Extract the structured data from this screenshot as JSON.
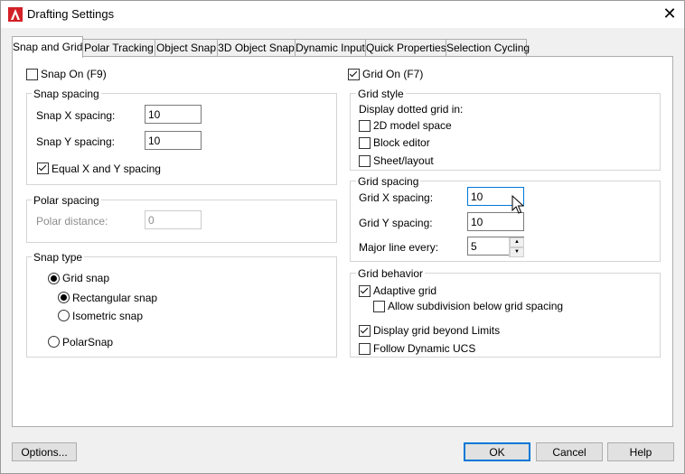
{
  "window": {
    "title": "Drafting Settings",
    "close_glyph": "✕"
  },
  "tabs": [
    "Snap and Grid",
    "Polar Tracking",
    "Object Snap",
    "3D Object Snap",
    "Dynamic Input",
    "Quick Properties",
    "Selection Cycling"
  ],
  "snap": {
    "snap_on": "Snap On (F9)",
    "spacing_legend": "Snap spacing",
    "x_label": "Snap X spacing:",
    "x_value": "10",
    "y_label": "Snap Y spacing:",
    "y_value": "10",
    "equal_label": "Equal X and Y spacing",
    "polar_legend": "Polar spacing",
    "polar_label": "Polar distance:",
    "polar_value": "0",
    "type_legend": "Snap type",
    "grid_snap": "Grid snap",
    "rect_snap": "Rectangular snap",
    "iso_snap": "Isometric snap",
    "polar_snap": "PolarSnap"
  },
  "grid": {
    "grid_on": "Grid On (F7)",
    "style_legend": "Grid style",
    "style_desc": "Display dotted grid in:",
    "model_space": "2D model space",
    "block_editor": "Block editor",
    "sheet_layout": "Sheet/layout",
    "spacing_legend": "Grid spacing",
    "x_label": "Grid X spacing:",
    "x_value": "10",
    "y_label": "Grid Y spacing:",
    "y_value": "10",
    "major_label": "Major line every:",
    "major_value": "5",
    "behavior_legend": "Grid behavior",
    "adaptive": "Adaptive grid",
    "subdivision": "Allow subdivision below grid spacing",
    "beyond_limits": "Display grid beyond Limits",
    "follow_ucs": "Follow Dynamic UCS"
  },
  "buttons": {
    "options": "Options...",
    "ok": "OK",
    "cancel": "Cancel",
    "help": "Help"
  },
  "colors": {
    "app_icon": "#d32027",
    "focus": "#0078d7"
  }
}
